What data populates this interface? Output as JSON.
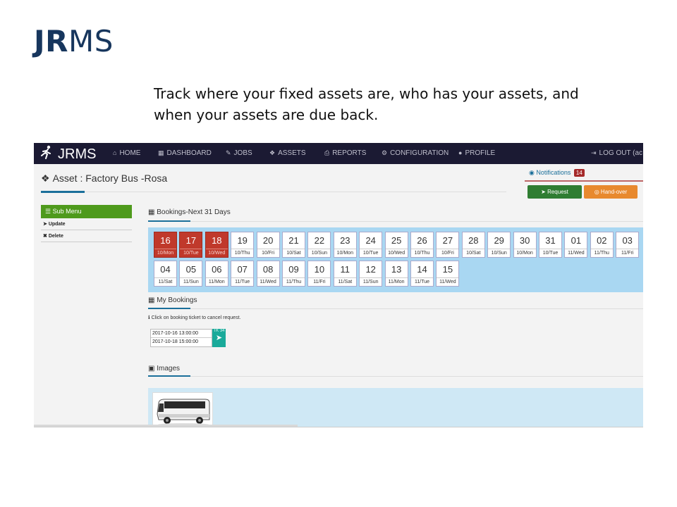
{
  "slide": {
    "title_bold": "JR",
    "title_rest": "MS",
    "caption": "Track where your fixed assets are, who has your assets, and when your assets are due back."
  },
  "navbar": {
    "brand": "JRMS",
    "items": [
      {
        "label": "HOME",
        "icon": "home-icon"
      },
      {
        "label": "DASHBOARD",
        "icon": "dashboard-icon"
      },
      {
        "label": "JOBS",
        "icon": "wrench-icon"
      },
      {
        "label": "ASSETS",
        "icon": "cubes-icon"
      },
      {
        "label": "REPORTS",
        "icon": "print-icon"
      },
      {
        "label": "CONFIGURATION",
        "icon": "gears-icon"
      },
      {
        "label": "PROFILE",
        "icon": "user-icon"
      }
    ],
    "logout": "LOG OUT (ac"
  },
  "page": {
    "title": "Asset : Factory Bus -Rosa"
  },
  "notifications": {
    "label": "Notifications",
    "count": "14"
  },
  "actions": {
    "request": "Request",
    "handover": "Hand-over"
  },
  "submenu": {
    "header": "Sub Menu",
    "items": [
      "Update",
      "Delete"
    ]
  },
  "bookings_calendar": {
    "title": "Bookings-Next 31 Days",
    "booked_color": "#c0392b",
    "days": [
      {
        "num": "16",
        "label": "10/Mon",
        "booked": true
      },
      {
        "num": "17",
        "label": "10/Tue",
        "booked": true
      },
      {
        "num": "18",
        "label": "10/Wed",
        "booked": true
      },
      {
        "num": "19",
        "label": "10/Thu",
        "booked": false
      },
      {
        "num": "20",
        "label": "10/Fri",
        "booked": false
      },
      {
        "num": "21",
        "label": "10/Sat",
        "booked": false
      },
      {
        "num": "22",
        "label": "10/Sun",
        "booked": false
      },
      {
        "num": "23",
        "label": "10/Mon",
        "booked": false
      },
      {
        "num": "24",
        "label": "10/Tue",
        "booked": false
      },
      {
        "num": "25",
        "label": "10/Wed",
        "booked": false
      },
      {
        "num": "26",
        "label": "10/Thu",
        "booked": false
      },
      {
        "num": "27",
        "label": "10/Fri",
        "booked": false
      },
      {
        "num": "28",
        "label": "10/Sat",
        "booked": false
      },
      {
        "num": "29",
        "label": "10/Sun",
        "booked": false
      },
      {
        "num": "30",
        "label": "10/Mon",
        "booked": false
      },
      {
        "num": "31",
        "label": "10/Tue",
        "booked": false
      },
      {
        "num": "01",
        "label": "11/Wed",
        "booked": false
      },
      {
        "num": "02",
        "label": "11/Thu",
        "booked": false
      },
      {
        "num": "03",
        "label": "11/Fri",
        "booked": false
      },
      {
        "num": "04",
        "label": "11/Sat",
        "booked": false
      },
      {
        "num": "05",
        "label": "11/Sun",
        "booked": false
      },
      {
        "num": "06",
        "label": "11/Mon",
        "booked": false
      },
      {
        "num": "07",
        "label": "11/Tue",
        "booked": false
      },
      {
        "num": "08",
        "label": "11/Wed",
        "booked": false
      },
      {
        "num": "09",
        "label": "11/Thu",
        "booked": false
      },
      {
        "num": "10",
        "label": "11/Fri",
        "booked": false
      },
      {
        "num": "11",
        "label": "11/Sat",
        "booked": false
      },
      {
        "num": "12",
        "label": "11/Sun",
        "booked": false
      },
      {
        "num": "13",
        "label": "11/Mon",
        "booked": false
      },
      {
        "num": "14",
        "label": "11/Tue",
        "booked": false
      },
      {
        "num": "15",
        "label": "11/Wed",
        "booked": false
      }
    ]
  },
  "my_bookings": {
    "title": "My Bookings",
    "hint": "Click on booking ticket to cancel request.",
    "tickets": [
      {
        "start": "2017-10-16 13:00:00",
        "end": "2017-10-18 15:00:00",
        "id": "TK 34"
      }
    ]
  },
  "images": {
    "title": "Images"
  }
}
